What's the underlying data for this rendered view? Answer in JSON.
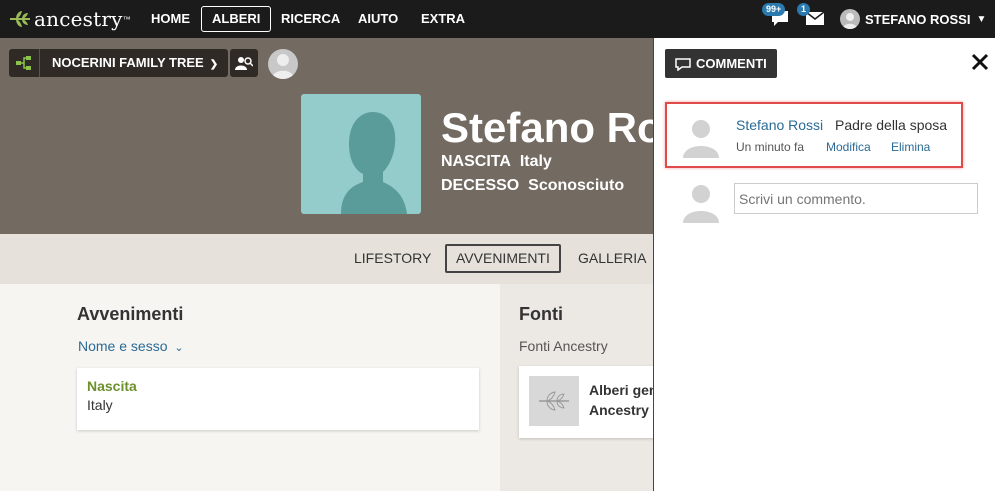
{
  "nav": {
    "logo_text": "ancestry",
    "items": [
      "HOME",
      "ALBERI",
      "RICERCA",
      "AIUTO",
      "EXTRA"
    ],
    "active": "ALBERI",
    "messages_badge": "99+",
    "mail_badge": "1",
    "user_name": "STEFANO ROSSI"
  },
  "tree": {
    "name": "NOCERINI FAMILY TREE"
  },
  "person": {
    "name": "Stefano Rossi",
    "birth_label": "NASCITA",
    "birth_value": "Italy",
    "death_label": "DECESSO",
    "death_value": "Sconosciuto"
  },
  "tabs": [
    "LIFESTORY",
    "AVVENIMENTI",
    "GALLERIA"
  ],
  "active_tab": "AVVENIMENTI",
  "events": {
    "title": "Avvenimenti",
    "filter": "Nome e sesso",
    "card_title": "Nascita",
    "card_value": "Italy"
  },
  "sources": {
    "title": "Fonti",
    "subtitle": "Fonti Ancestry",
    "card_line1": "Alberi gen",
    "card_line2": "Ancestry"
  },
  "comments": {
    "button_label": "COMMENTI",
    "author": "Stefano Rossi",
    "text": "Padre della sposa",
    "time": "Un minuto fa",
    "edit": "Modifica",
    "delete": "Elimina",
    "input_placeholder": "Scrivi un commento."
  },
  "colors": {
    "nav_bg": "#1b1b1b",
    "header_bg": "#736a62",
    "portrait_bg": "#93cccb",
    "link": "#2a6a94",
    "event_green": "#6d8f2c",
    "highlight": "#e04a4a",
    "badge": "#2a7ab0"
  }
}
